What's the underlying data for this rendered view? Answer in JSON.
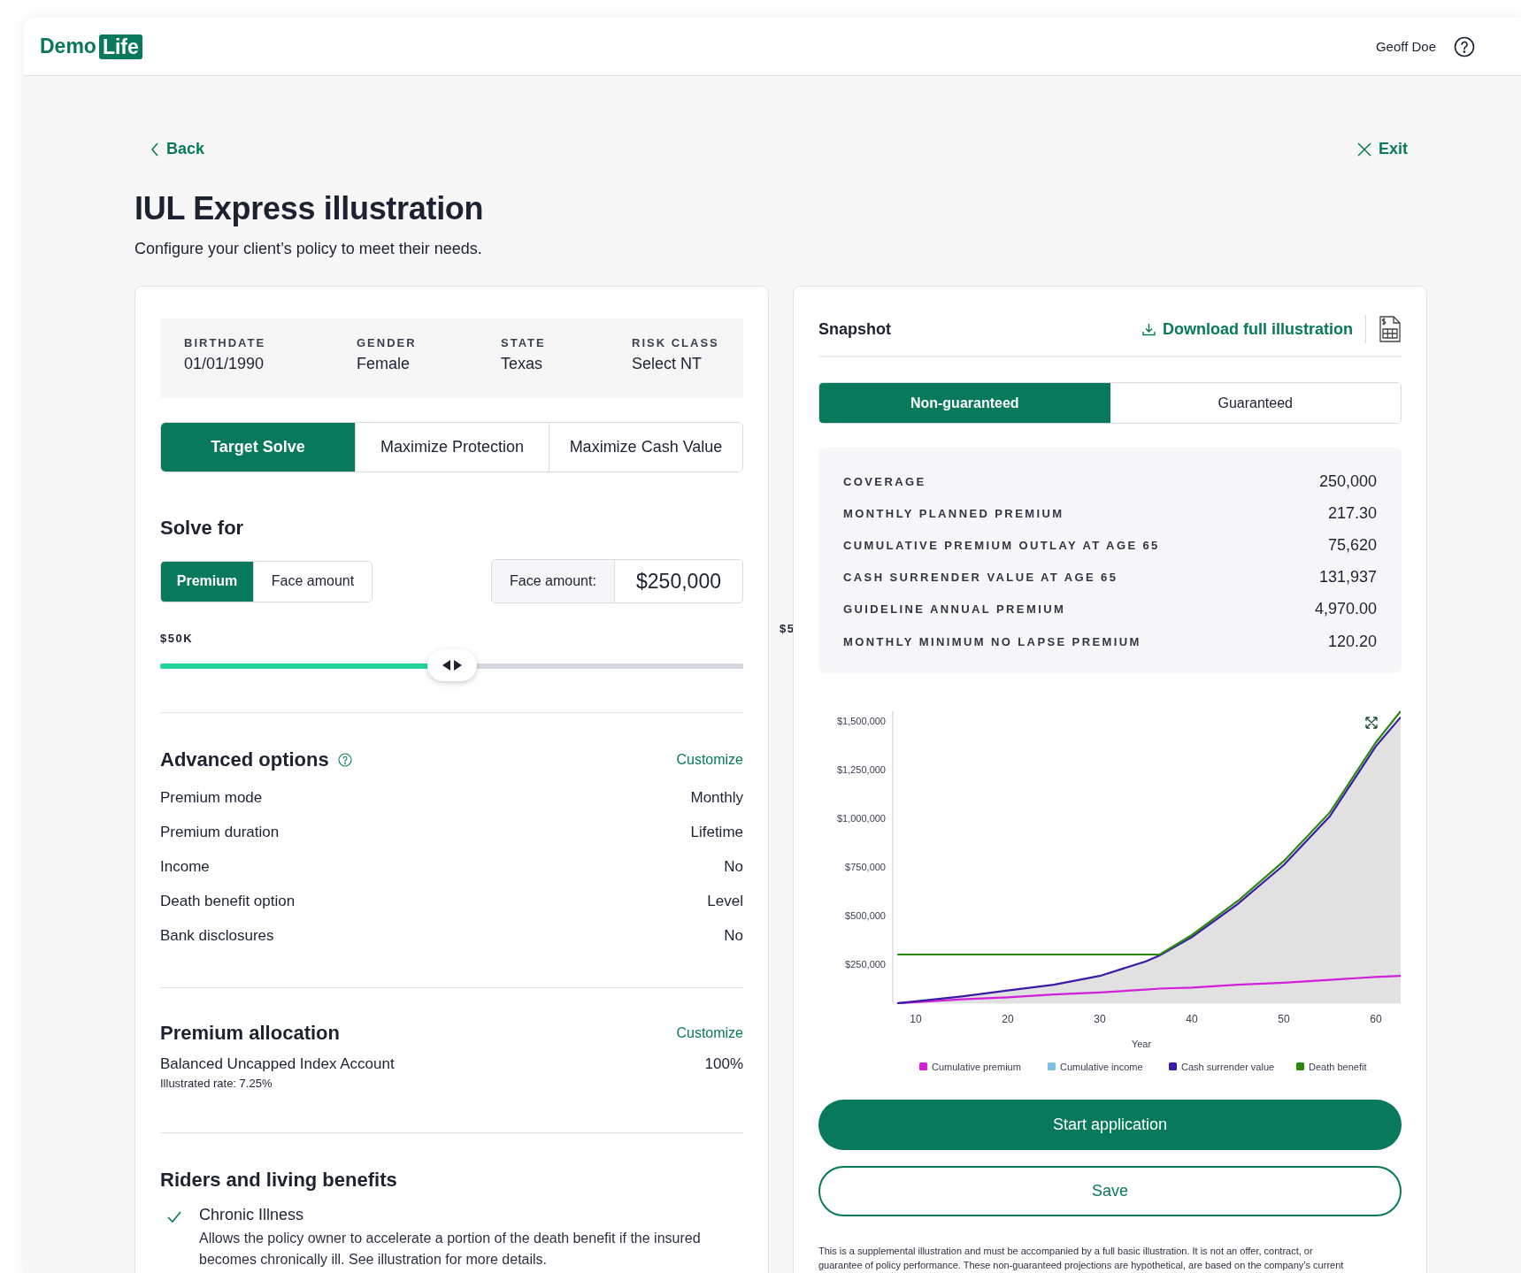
{
  "header": {
    "logo": {
      "part_1": "Demo",
      "part_2": "Life"
    },
    "user_name": "Geoff Doe"
  },
  "nav": {
    "back": "Back",
    "exit": "Exit"
  },
  "page": {
    "title": "IUL Express illustration",
    "subtitle": "Configure your client’s policy to meet their needs."
  },
  "client_info": [
    {
      "label": "BIRTHDATE",
      "value": "01/01/1990"
    },
    {
      "label": "GENDER",
      "value": "Female"
    },
    {
      "label": "STATE",
      "value": "Texas"
    },
    {
      "label": "RISK CLASS",
      "value": "Select NT"
    }
  ],
  "solve_tabs": [
    {
      "label": "Target Solve",
      "selected": true
    },
    {
      "label": "Maximize Protection",
      "selected": false
    },
    {
      "label": "Maximize Cash Value",
      "selected": false
    }
  ],
  "solve_for": {
    "title": "Solve for",
    "options": [
      {
        "label": "Premium",
        "selected": true
      },
      {
        "label": "Face amount",
        "selected": false
      }
    ],
    "field_label": "Face amount:",
    "field_value": "$250,000",
    "slider": {
      "min_label": "$50K",
      "max_label": "$5",
      "level": 0.5
    }
  },
  "advanced_options": {
    "title": "Advanced options",
    "action": "Customize",
    "rows": [
      {
        "label": "Premium mode",
        "value": "Monthly"
      },
      {
        "label": "Premium duration",
        "value": "Lifetime"
      },
      {
        "label": "Income",
        "value": "No"
      },
      {
        "label": "Death benefit option",
        "value": "Level"
      },
      {
        "label": "Bank disclosures",
        "value": "No"
      }
    ]
  },
  "premium_allocation": {
    "title": "Premium allocation",
    "action": "Customize",
    "rows": [
      {
        "label": "Balanced Uncapped Index Account",
        "value": "100%",
        "note": "Illustrated rate: 7.25%"
      }
    ]
  },
  "riders": {
    "title": "Riders and living benefits",
    "items": [
      {
        "name": "Chronic Illness",
        "checked": true,
        "description": "Allows the policy owner to accelerate a portion of the death benefit if the insured becomes chronically ill. See illustration for more details."
      }
    ]
  },
  "snapshot": {
    "title": "Snapshot",
    "download": "Download full illustration",
    "views": [
      {
        "label": "Non-guaranteed",
        "selected": true
      },
      {
        "label": "Guaranteed",
        "selected": false
      }
    ],
    "stats": [
      {
        "label": "COVERAGE",
        "value": "250,000"
      },
      {
        "label": "MONTHLY PLANNED PREMIUM",
        "value": "217.30"
      },
      {
        "label": "CUMULATIVE PREMIUM OUTLAY AT AGE 65",
        "value": "75,620"
      },
      {
        "label": "CASH SURRENDER VALUE AT AGE 65",
        "value": "131,937"
      },
      {
        "label": "GUIDELINE ANNUAL PREMIUM",
        "value": "4,970.00"
      },
      {
        "label": "MONTHLY MINIMUM NO LAPSE PREMIUM",
        "value": "120.20"
      }
    ],
    "chart_data": {
      "type": "line",
      "xlabel": "Year",
      "x": [
        8,
        10,
        15,
        20,
        25,
        30,
        35,
        36.5,
        40,
        45,
        50,
        55,
        60,
        62.7
      ],
      "xlim": [
        7.5,
        62.7
      ],
      "ylim": [
        50000,
        1550000
      ],
      "xticks": [
        10,
        20,
        30,
        40,
        50,
        60
      ],
      "legend": "bottom",
      "yticks": [
        {
          "value": 250000,
          "label": "$250,000"
        },
        {
          "value": 500000,
          "label": "$500,000"
        },
        {
          "value": 750000,
          "label": "$750,000"
        },
        {
          "value": 1000000,
          "label": "$1,000,000"
        },
        {
          "value": 1250000,
          "label": "$1,250,000"
        },
        {
          "value": 1500000,
          "label": "$1,500,000"
        }
      ],
      "series": [
        {
          "name": "Cumulative premium",
          "color": "#d21fd9",
          "values": [
            50000,
            55000,
            70000,
            80000,
            95000,
            105000,
            120000,
            125000,
            130000,
            145000,
            155000,
            170000,
            185000,
            190000
          ]
        },
        {
          "name": "Cumulative income",
          "color": "#7fbfe0",
          "values": [
            null,
            null,
            null,
            null,
            null,
            null,
            null,
            null,
            null,
            null,
            null,
            null,
            null,
            null
          ]
        },
        {
          "name": "Cash surrender value",
          "color": "#3a1aa6",
          "values": [
            50000,
            60000,
            85000,
            115000,
            145000,
            190000,
            265000,
            295000,
            390000,
            560000,
            760000,
            1010000,
            1370000,
            1520000
          ]
        },
        {
          "name": "Death benefit",
          "color": "#2a8a0e",
          "values": [
            300000,
            300000,
            300000,
            300000,
            300000,
            300000,
            300000,
            300000,
            400000,
            575000,
            780000,
            1030000,
            1390000,
            1550000
          ]
        }
      ]
    },
    "primary_button": "Start application",
    "secondary_button": "Save",
    "disclaimer": "This is a supplemental illustration and must be accompanied by a full basic illustration.  It is not an offer, contract, or guarantee of policy performance. These non-guaranteed projections are hypothetical, are based on the company’s current"
  }
}
